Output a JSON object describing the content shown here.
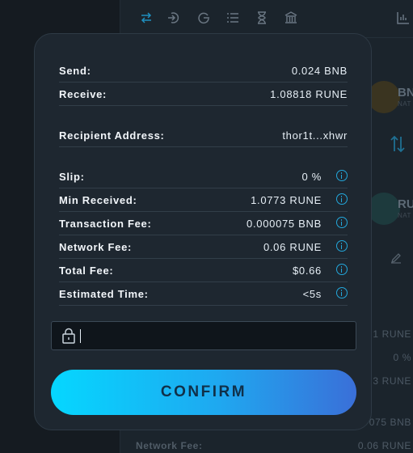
{
  "background": {
    "toolbar_icons": [
      "swap-icon",
      "add-liquidity-icon",
      "withdraw-icon",
      "list-icon",
      "hourglass-icon",
      "bank-icon",
      "chart-icon"
    ],
    "assets": [
      {
        "label": "BN",
        "sub": "NAT",
        "color": "#f0b90b"
      },
      {
        "label": "RU",
        "sub": "NAT",
        "color": "#23dcc8"
      }
    ],
    "right_values": [
      "1 RUNE",
      "0 %",
      "3 RUNE",
      "075 BNB"
    ],
    "bottom_label": "Network Fee:",
    "bottom_value": "0.06 RUNE"
  },
  "modal": {
    "send": {
      "label": "Send:",
      "value": "0.024 BNB"
    },
    "receive": {
      "label": "Receive:",
      "value": "1.08818 RUNE"
    },
    "recipient": {
      "label": "Recipient Address:",
      "value": "thor1t...xhwr"
    },
    "slip": {
      "label": "Slip:",
      "value": "0 %"
    },
    "min_received": {
      "label": "Min Received:",
      "value": "1.0773 RUNE"
    },
    "tx_fee": {
      "label": "Transaction Fee:",
      "value": "0.000075 BNB"
    },
    "network_fee": {
      "label": "Network Fee:",
      "value": "0.06 RUNE"
    },
    "total_fee": {
      "label": "Total Fee:",
      "value": "$0.66"
    },
    "est_time": {
      "label": "Estimated Time:",
      "value": "<5s"
    },
    "password_value": "",
    "confirm_label": "CONFIRM"
  },
  "colors": {
    "accent": "#23a8dc",
    "button_start": "#05d7ff",
    "button_end": "#3a6fd8"
  }
}
